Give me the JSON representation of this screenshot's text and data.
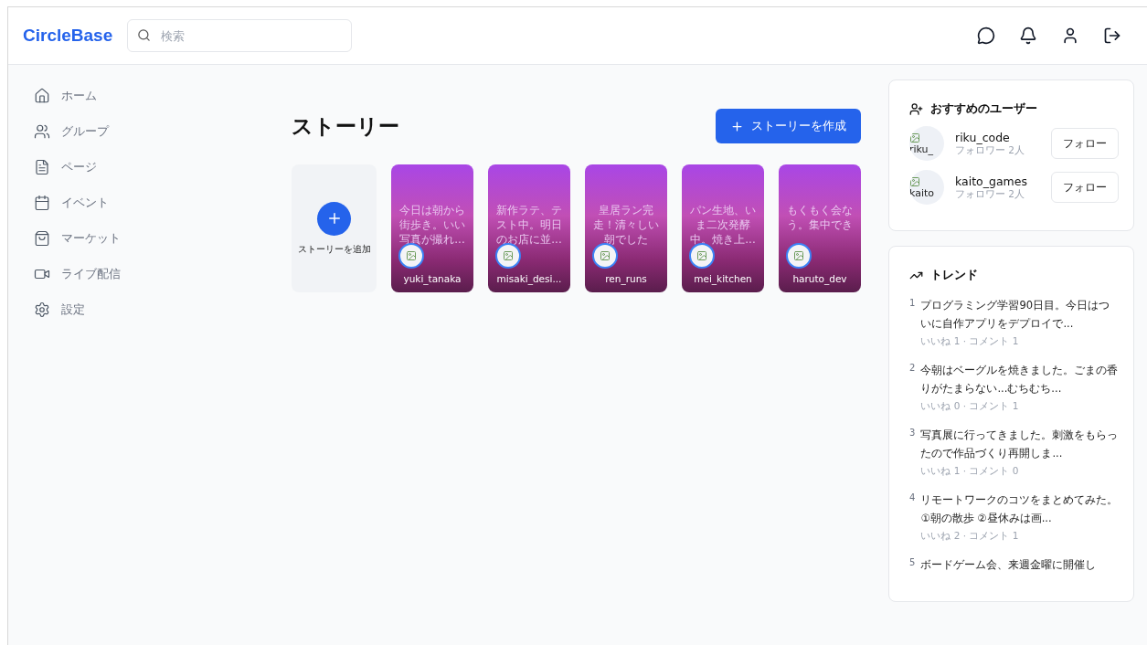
{
  "header": {
    "logo": "CircleBase",
    "search": {
      "placeholder": "検索"
    }
  },
  "sidebar": {
    "items": [
      {
        "kind": "home",
        "label": "ホーム"
      },
      {
        "kind": "users",
        "label": "グループ"
      },
      {
        "kind": "page",
        "label": "ページ"
      },
      {
        "kind": "calendar",
        "label": "イベント"
      },
      {
        "kind": "bag",
        "label": "マーケット"
      },
      {
        "kind": "video",
        "label": "ライブ配信"
      },
      {
        "kind": "gear",
        "label": "設定"
      }
    ]
  },
  "stories": {
    "title": "ストーリー",
    "create_button": "ストーリーを作成",
    "add_label": "ストーリーを追加",
    "items": [
      {
        "text": "今日は朝から街歩き。いい写真が撮れ...",
        "user": "yuki_tanaka"
      },
      {
        "text": "新作ラテ、テスト中。明日のお店に並...",
        "user": "misaki_desi..."
      },
      {
        "text": "皇居ラン完走！清々しい朝でした",
        "user": "ren_runs"
      },
      {
        "text": "パン生地、いま二次発酵中。焼き上...",
        "user": "mei_kitchen"
      },
      {
        "text": "もくもく会なう。集中でき",
        "user": "haruto_dev"
      }
    ]
  },
  "suggested": {
    "title": "おすすめのユーザー",
    "users": [
      {
        "avatar_alt": "riku_",
        "name": "riku_code",
        "followers": "フォロワー 2人",
        "button": "フォロー"
      },
      {
        "avatar_alt": "kaito",
        "name": "kaito_games",
        "followers": "フォロワー 2人",
        "button": "フォロー"
      }
    ]
  },
  "trends": {
    "title": "トレンド",
    "items": [
      {
        "rank": "1",
        "text": "プログラミング学習90日目。今日はついに自作アプリをデプロイで...",
        "meta": "いいね 1 · コメント 1"
      },
      {
        "rank": "2",
        "text": "今朝はベーグルを焼きました。ごまの香りがたまらない...むちむち...",
        "meta": "いいね 0 · コメント 1"
      },
      {
        "rank": "3",
        "text": "写真展に行ってきました。刺激をもらったので作品づくり再開しま...",
        "meta": "いいね 1 · コメント 0"
      },
      {
        "rank": "4",
        "text": "リモートワークのコツをまとめてみた。①朝の散歩 ②昼休みは画...",
        "meta": "いいね 2 · コメント 1"
      },
      {
        "rank": "5",
        "text": "ボードゲーム会、来週金曜に開催し"
      }
    ]
  }
}
